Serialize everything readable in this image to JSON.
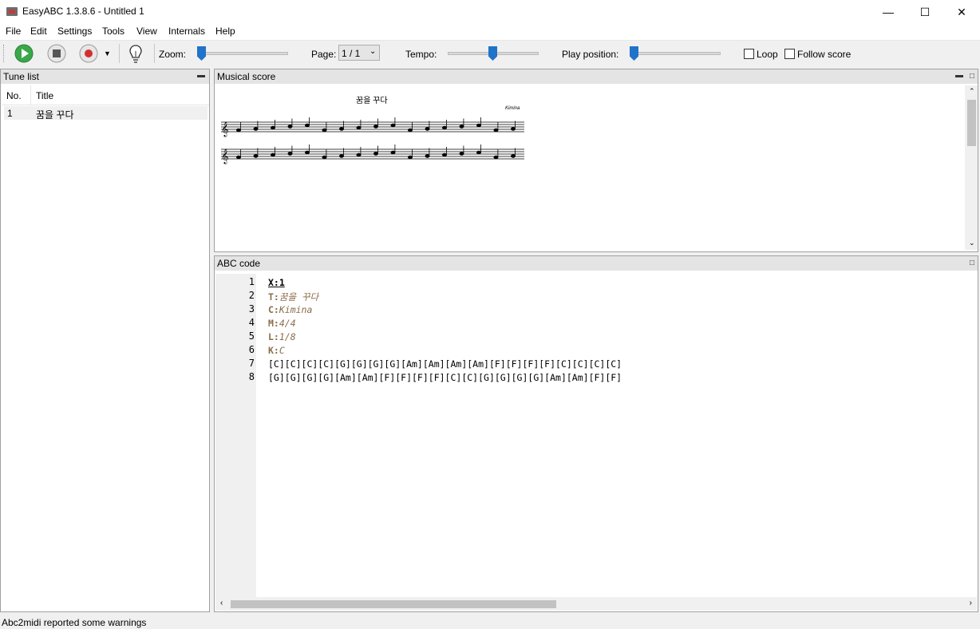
{
  "window": {
    "title": "EasyABC 1.3.8.6 - Untitled 1",
    "minimize": "—",
    "maximize": "☐",
    "close": "✕"
  },
  "menu": [
    "File",
    "Edit",
    "Settings",
    "Tools",
    "View",
    "Internals",
    "Help"
  ],
  "toolbar": {
    "zoom_label": "Zoom:",
    "page_label": "Page:",
    "page_value": "1 / 1",
    "tempo_label": "Tempo:",
    "play_position_label": "Play position:",
    "loop_label": "Loop",
    "follow_score_label": "Follow score",
    "zoom_level": 0.0,
    "tempo_level": 0.5,
    "play_position_level": 0.0
  },
  "tune_list": {
    "title": "Tune list",
    "columns": [
      "No.",
      "Title"
    ],
    "rows": [
      {
        "no": "1",
        "title": "꿈을 꾸다"
      }
    ]
  },
  "score": {
    "pane_title": "Musical score",
    "tune_title": "꿈을 꾸다",
    "composer": "Kimina"
  },
  "abc": {
    "pane_title": "ABC code",
    "lines": [
      {
        "n": "1",
        "key": "X:",
        "val": "1"
      },
      {
        "n": "2",
        "key": "T:",
        "val": "꿈을 꾸다"
      },
      {
        "n": "3",
        "key": "C:",
        "val": "Kimina"
      },
      {
        "n": "4",
        "key": "M:",
        "val": "4/4"
      },
      {
        "n": "5",
        "key": "L:",
        "val": "1/8"
      },
      {
        "n": "6",
        "key": "K:",
        "val": "C"
      },
      {
        "n": "7",
        "key": "",
        "val": "[C][C][C][C][G][G][G][G][Am][Am][Am][Am][F][F][F][F][C][C][C][C]"
      },
      {
        "n": "8",
        "key": "",
        "val": "[G][G][G][G][Am][Am][F][F][F][F][C][C][G][G][G][G][Am][Am][F][F]"
      }
    ]
  },
  "status": "Abc2midi reported some warnings",
  "colors": {
    "accent": "#1f73c9",
    "play_green": "#3aa84a",
    "record_red": "#d32f2f",
    "header_brown": "#8b6d4a"
  }
}
